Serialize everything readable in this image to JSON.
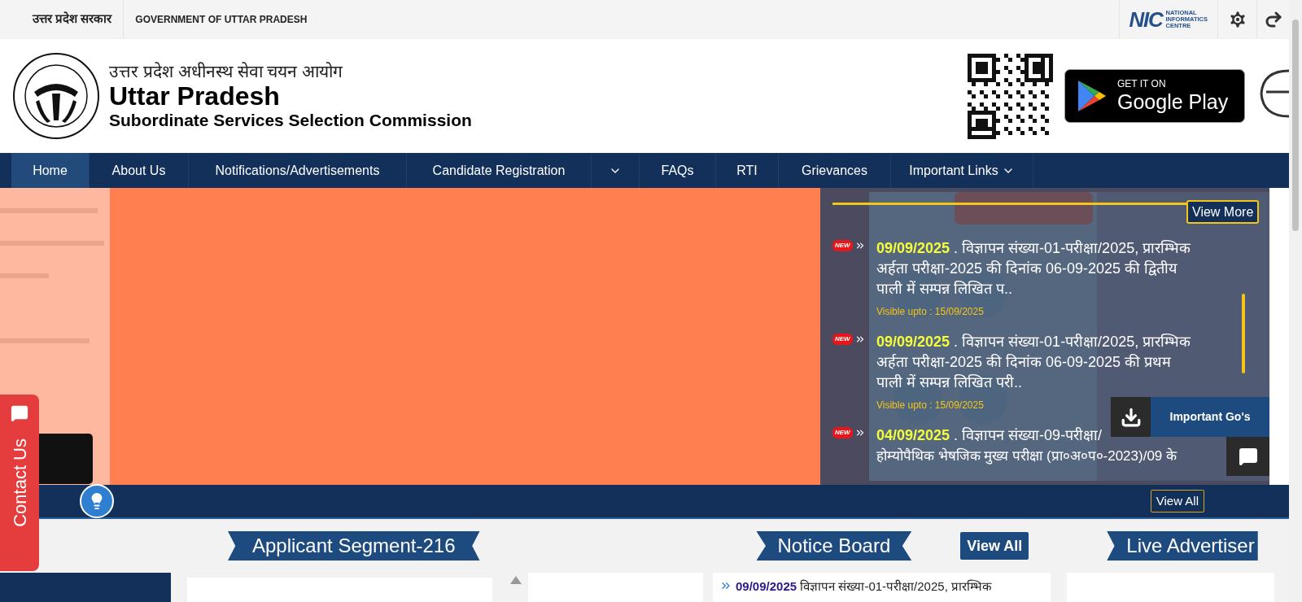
{
  "top_bar": {
    "hindi_title": "उत्तर प्रदेश सरकार",
    "english_title": "GOVERNMENT OF UTTAR PRADESH",
    "nic_logo": {
      "mark": "NIC",
      "lines": [
        "NATIONAL",
        "INFORMATICS",
        "CENTRE"
      ]
    }
  },
  "header": {
    "hindi_name": "उत्तर प्रदेश अधीनस्थ सेवा चयन आयोग",
    "title": "Uttar Pradesh",
    "subtitle": "Subordinate Services Selection Commission",
    "play_badge": {
      "small": "GET IT ON",
      "large": "Google Play"
    }
  },
  "nav": [
    {
      "label": "Home",
      "caret": false,
      "selected": true
    },
    {
      "label": "About Us",
      "caret": false,
      "selected": false
    },
    {
      "label": "Notifications/Advertisements",
      "caret": false,
      "selected": false
    },
    {
      "label": "Candidate Registration",
      "caret": false,
      "selected": false
    },
    {
      "caret": true,
      "selected": false
    },
    {
      "label": "FAQs",
      "caret": false,
      "selected": false
    },
    {
      "label": "RTI",
      "caret": false,
      "selected": false
    },
    {
      "label": "Grievances",
      "caret": false,
      "selected": false
    },
    {
      "label": "Important Links",
      "caret": true,
      "selected": false
    }
  ],
  "notices": {
    "view_more": "View More",
    "items": [
      {
        "date": "09/09/2025",
        "text": ". विज्ञापन संख्या-01-परीक्षा/2025, प्रारम्भिक अर्हता परीक्षा-2025 की दिनांक 06-09-2025 की द्वितीय पाली में सम्पन्न लिखित प..",
        "visible": "Visible upto : 15/09/2025",
        "badge": "NEW"
      },
      {
        "date": "09/09/2025",
        "text": ". विज्ञापन संख्या-01-परीक्षा/2025, प्रारम्भिक अर्हता परीक्षा-2025 की दिनांक 06-09-2025 की प्रथम पाली में सम्पन्न लिखित परी..",
        "visible": "Visible upto : 15/09/2025",
        "badge": "NEW"
      },
      {
        "date": "04/09/2025",
        "text": ". विज्ञापन संख्या-09-परीक्षा/",
        "continuation": "होम्योपैथिक भेषजिक मुख्य परीक्षा (प्रा०अ०प०-2023)/09 के",
        "badge": "NEW"
      }
    ]
  },
  "contact_tab": "Contact Us",
  "important_gos": "Important Go's",
  "strip": {
    "view_all": "View All"
  },
  "sections": {
    "applicant": "Applicant Segment-216",
    "notice_board": "Notice Board",
    "notice_view_all": "View All",
    "live": "Live Advertiser",
    "first_notice": {
      "date": "09/09/2025",
      "text": "विज्ञापन संख्या-01-परीक्षा/2025, प्रारम्भिक"
    }
  }
}
